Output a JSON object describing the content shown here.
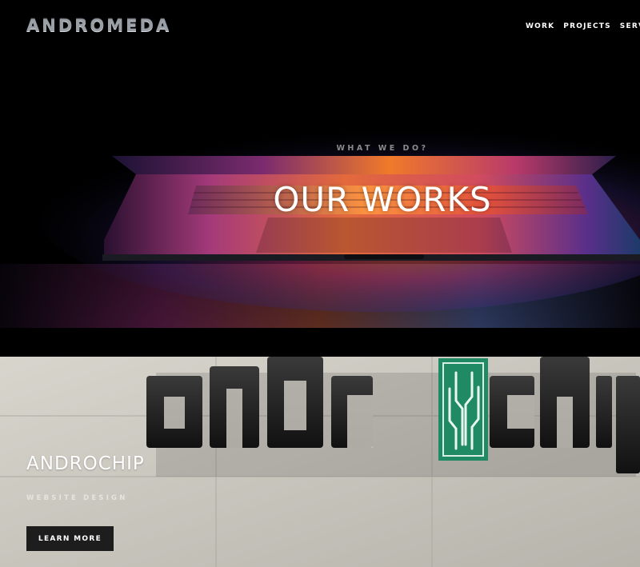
{
  "brand": {
    "logo_text": "ANDROMEDA"
  },
  "nav": {
    "items": [
      "WORK",
      "PROJECTS",
      "SERVICES"
    ]
  },
  "hero": {
    "eyebrow": "WHAT WE DO?",
    "title": "OUR WORKS"
  },
  "project": {
    "title": "ANDROCHIP",
    "subtitle": "WEBSITE DESIGN",
    "button_label": "LEARN MORE",
    "sign_text": "andr chip"
  },
  "colors": {
    "hero_bg": "#000000",
    "button_bg": "#1d1d1d",
    "chip_green": "#1f8a63"
  }
}
